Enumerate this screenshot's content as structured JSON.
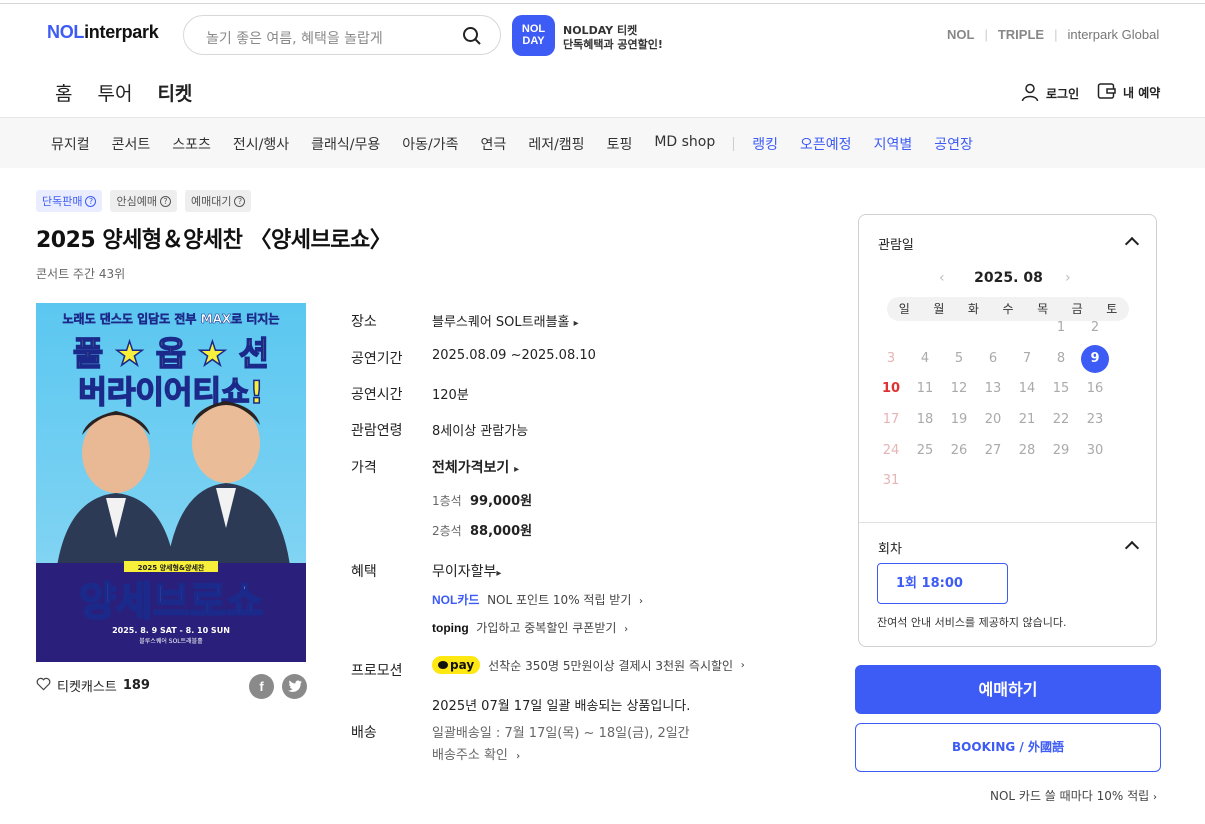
{
  "header": {
    "logo_nol": "NOL",
    "logo_text": "interpark",
    "search_placeholder": "놀기 좋은 여름, 혜택을 놀랍게",
    "nolday_badge_line1": "NOL",
    "nolday_badge_line2": "DAY",
    "nolday_title": "NOLDAY 티켓",
    "nolday_sub": "단독혜택과 공연할인!",
    "brands": [
      "NOL",
      "TRIPLE",
      "interpark Global"
    ],
    "gnb": [
      "홈",
      "투어",
      "티켓"
    ],
    "login_label": "로그인",
    "reservation_label": "내 예약"
  },
  "categories": [
    "뮤지컬",
    "콘서트",
    "스포츠",
    "전시/행사",
    "클래식/무용",
    "아동/가족",
    "연극",
    "레저/캠핑",
    "토핑",
    "MD shop"
  ],
  "categories_blue": [
    "랭킹",
    "오픈예정",
    "지역별",
    "공연장"
  ],
  "product": {
    "badges": [
      "단독판매",
      "안심예매",
      "예매대기"
    ],
    "title": "2025 양세형＆양세찬 〈양세브로쇼〉",
    "rank": "콘서트 주간 43위",
    "likes_label": "티켓캐스트",
    "likes_count": "189",
    "poster": {
      "top_line": "노래도 댄스도 입담도 전부 MAX로 터지는",
      "big1": "풀 ★ 옵 ★ 션",
      "big2": "버라이어티쇼!",
      "name_tag": "2025 양세형&양세찬",
      "show_title": "양세브로쇼",
      "date": "2025. 8. 9 SAT - 8. 10 SUN",
      "venue": "블루스퀘어 SOL트래블홀"
    }
  },
  "info": {
    "venue_label": "장소",
    "venue": "블루스퀘어 SOL트래블홀",
    "period_label": "공연기간",
    "period": "2025.08.09 ~2025.08.10",
    "runtime_label": "공연시간",
    "runtime": "120분",
    "age_label": "관람연령",
    "age": "8세이상 관람가능",
    "price_label": "가격",
    "price_all": "전체가격보기",
    "prices": [
      {
        "seat": "1층석",
        "price": "99,000원"
      },
      {
        "seat": "2층석",
        "price": "88,000원"
      }
    ],
    "benefit_label": "혜택",
    "benefit_main": "무이자할부",
    "benefit_nol_logo": "NOL카드",
    "benefit_nol": "NOL 포인트 10% 적립 받기",
    "benefit_toping_logo": "toping",
    "benefit_toping": "가입하고 중복할인 쿠폰받기",
    "promo_label": "프로모션",
    "promo_pay": "pay",
    "promo_text": "선착순 350명 5만원이상 결제시 3천원 즉시할인",
    "delivery_notice": "2025년 07월 17일 일괄 배송되는 상품입니다.",
    "delivery_label": "배송",
    "delivery_date": "일괄배송일 : 7월 17일(목) ~ 18일(금), 2일간",
    "delivery_address": "배송주소 확인"
  },
  "calendar": {
    "header": "관람일",
    "month": "2025. 08",
    "dow": [
      "일",
      "월",
      "화",
      "수",
      "목",
      "금",
      "토"
    ],
    "days": [
      "1",
      "2",
      "3",
      "4",
      "5",
      "6",
      "7",
      "8",
      "9",
      "10",
      "11",
      "12",
      "13",
      "14",
      "15",
      "16",
      "17",
      "18",
      "19",
      "20",
      "21",
      "22",
      "23",
      "24",
      "25",
      "26",
      "27",
      "28",
      "29",
      "30",
      "31"
    ],
    "selected_day": "9",
    "session_header": "회차",
    "session": "1회 18:00",
    "note": "잔여석 안내 서비스를 제공하지 않습니다."
  },
  "actions": {
    "buy": "예매하기",
    "booking": "BOOKING / 外國語",
    "nolcard_note": "NOL 카드 쓸 때마다 10% 적립"
  },
  "colors": {
    "accent": "#3d5bf5",
    "kakao": "#ffe812",
    "sunday": "#e03131"
  }
}
